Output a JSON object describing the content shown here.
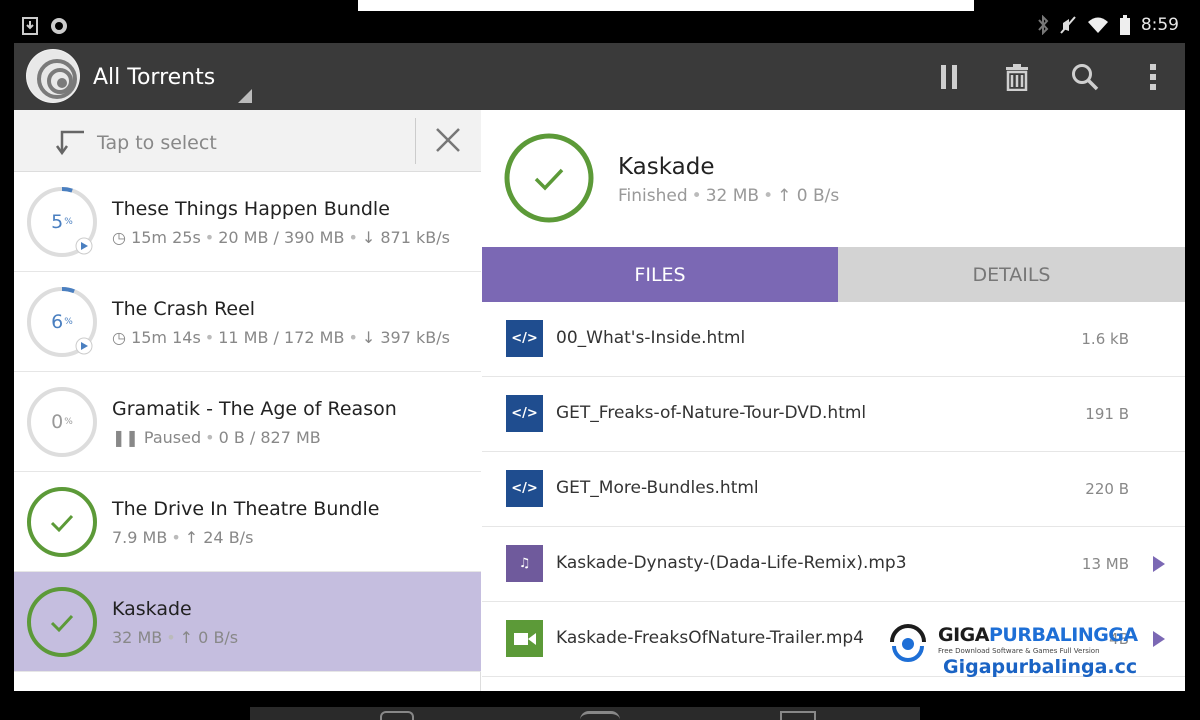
{
  "status_bar": {
    "time": "8:59"
  },
  "action_bar": {
    "title": "All Torrents"
  },
  "select_bar": {
    "label": "Tap to select"
  },
  "torrents": [
    {
      "name": "These Things Happen Bundle",
      "progress": "5",
      "pct_unit": "%",
      "progress_fraction": 0.05,
      "meta": [
        "15m 25s",
        "20 MB / 390 MB",
        "871 kB/s"
      ],
      "state": "downloading"
    },
    {
      "name": "The Crash Reel",
      "progress": "6",
      "pct_unit": "%",
      "progress_fraction": 0.06,
      "meta": [
        "15m 14s",
        "11 MB / 172 MB",
        "397 kB/s"
      ],
      "state": "downloading"
    },
    {
      "name": "Gramatik - The Age of Reason",
      "progress": "0",
      "pct_unit": "%",
      "progress_fraction": 0.0,
      "meta": [
        "Paused",
        "0 B / 827 MB"
      ],
      "state": "paused"
    },
    {
      "name": "The Drive In Theatre Bundle",
      "meta": [
        "7.9 MB",
        "24 B/s"
      ],
      "state": "finished"
    },
    {
      "name": "Kaskade",
      "meta": [
        "32 MB",
        "0 B/s"
      ],
      "state": "finished",
      "selected": true
    }
  ],
  "detail": {
    "name": "Kaskade",
    "status": "Finished",
    "size": "32 MB",
    "upload": "0 B/s"
  },
  "tabs": {
    "files": "FILES",
    "details": "DETAILS"
  },
  "files": [
    {
      "name": "00_What's-Inside.html",
      "size": "1.6 kB",
      "type": "html"
    },
    {
      "name": "GET_Freaks-of-Nature-Tour-DVD.html",
      "size": "191 B",
      "type": "html"
    },
    {
      "name": "GET_More-Bundles.html",
      "size": "220 B",
      "type": "html"
    },
    {
      "name": "Kaskade-Dynasty-(Dada-Life-Remix).mp3",
      "size": "13 MB",
      "type": "audio"
    },
    {
      "name": "Kaskade-FreaksOfNature-Trailer.mp4",
      "size": "4B",
      "type": "video"
    }
  ],
  "watermark": {
    "brand_a": "GIGA",
    "brand_b": "PURBALINGGA",
    "tagline": "Free Download Software & Games Full Version",
    "url": "Gigapurbalinga.cc"
  },
  "colors": {
    "accent": "#7b68b4",
    "finished": "#5c9a38",
    "progress": "#4a7fc0",
    "action_bar": "#3a3a3a"
  }
}
